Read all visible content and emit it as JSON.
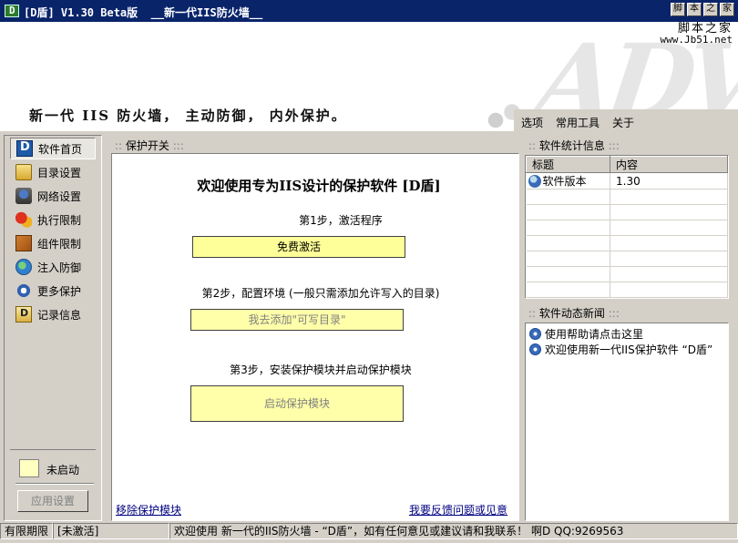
{
  "window": {
    "title": "[D盾] V1.30 Beta版  __新一代IIS防火墙__",
    "sys_buttons": [
      "脚",
      "本",
      "之",
      "家"
    ]
  },
  "banner": {
    "site_cn": "脚本之家",
    "site_url": "www.Jb51.net",
    "bg_letters": "ADV",
    "slogan": "新一代 IIS 防火墙， 主动防御， 内外保护。",
    "menu": [
      "选项",
      "常用工具",
      "关于"
    ]
  },
  "nav": {
    "items": [
      {
        "label": "软件首页",
        "icon": "home-icon"
      },
      {
        "label": "目录设置",
        "icon": "folder-icon"
      },
      {
        "label": "网络设置",
        "icon": "network-icon"
      },
      {
        "label": "执行限制",
        "icon": "exec-icon"
      },
      {
        "label": "组件限制",
        "icon": "component-icon"
      },
      {
        "label": "注入防御",
        "icon": "globe-icon"
      },
      {
        "label": "更多保护",
        "icon": "more-icon"
      },
      {
        "label": "记录信息",
        "icon": "log-icon"
      }
    ],
    "status_text": "未启动",
    "app_settings_label": "应用设置"
  },
  "main": {
    "section_title": "保护开关",
    "welcome": "欢迎使用专为IIS设计的保护软件 [D盾]",
    "step1_label": "第1步，激活程序",
    "step1_button": "免费激活",
    "step2_label": "第2步，配置环境 (一般只需添加允许写入的目录)",
    "step2_button": "我去添加\"可写目录\"",
    "step3_label": "第3步，安装保护模块并启动保护模块",
    "step3_button": "启动保护模块",
    "link_remove": "移除保护模块",
    "link_feedback": "我要反馈问题或见意"
  },
  "stats": {
    "section_title": "软件统计信息",
    "col_title": "标题",
    "col_content": "内容",
    "row1_title": "软件版本",
    "row1_value": "1.30"
  },
  "news": {
    "section_title": "软件动态新闻",
    "items": [
      "使用帮助请点击这里",
      "欢迎使用新一代IIS保护软件 “D盾”"
    ]
  },
  "statusbar": {
    "period_label": "有限期限",
    "activation": "[未激活]",
    "message": "欢迎使用 新一代的IIS防火墙 - “D盾”，如有任何意见或建议请和我联系！ 啊D  QQ:9269563"
  }
}
